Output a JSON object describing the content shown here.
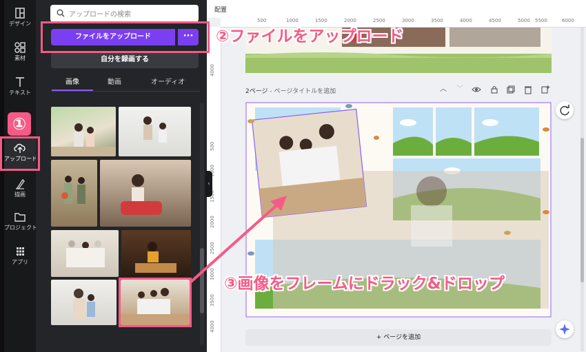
{
  "rail": {
    "items": [
      {
        "label": "デザイン",
        "icon": "layout-icon"
      },
      {
        "label": "素材",
        "icon": "shapes-icon"
      },
      {
        "label": "テキスト",
        "icon": "text-icon"
      },
      {
        "label": "アップロード",
        "icon": "cloud-upload-icon"
      },
      {
        "label": "描画",
        "icon": "pen-icon"
      },
      {
        "label": "プロジェクト",
        "icon": "folder-icon"
      },
      {
        "label": "アプリ",
        "icon": "apps-grid-icon"
      }
    ]
  },
  "panel": {
    "search_placeholder": "アップロードの検索",
    "upload_button": "ファイルをアップロード",
    "more_button": "···",
    "record_button": "自分を録画する",
    "tabs": [
      "画像",
      "動画",
      "オーディオ"
    ],
    "active_tab": "画像"
  },
  "editor": {
    "section_label": "配置",
    "ruler_top": [
      "500",
      "1000",
      "1500",
      "2000",
      "2500",
      "3000",
      "3500",
      "4000",
      "4500",
      "5000",
      "5500",
      "6000"
    ],
    "ruler_left": [
      "4000",
      "500",
      "1000",
      "1500",
      "2000",
      "2500",
      "3000",
      "3500",
      "4000"
    ],
    "page2_number": "2ページ",
    "page2_title_hint": " - ページタイトルを追加",
    "add_page": "+ ページを追加"
  },
  "annotations": {
    "step1": "①",
    "step2": "②ファイルをアップロード",
    "step3": "③画像をフレームにドラック&ドロップ"
  },
  "colors": {
    "accent_purple": "#7b3ff2",
    "annotation_pink": "#f65a86",
    "panel_dark": "#242528",
    "rail_dark": "#18191b"
  }
}
